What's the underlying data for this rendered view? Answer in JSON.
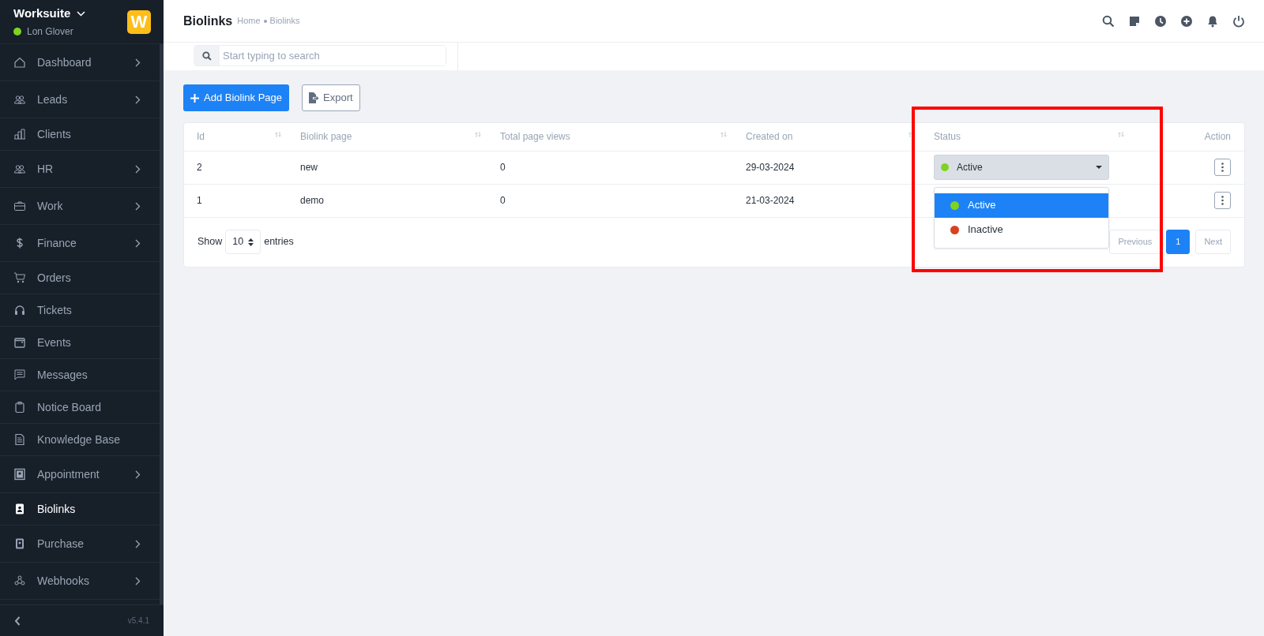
{
  "sidebar": {
    "company": "Worksuite",
    "user": "Lon Glover",
    "online": true,
    "logo_letter": "W",
    "items": [
      {
        "label": "Dashboard",
        "has_submenu": true,
        "selected": false
      },
      {
        "label": "Leads",
        "has_submenu": true,
        "selected": false
      },
      {
        "label": "Clients",
        "has_submenu": false,
        "selected": false
      },
      {
        "label": "HR",
        "has_submenu": true,
        "selected": false
      },
      {
        "label": "Work",
        "has_submenu": true,
        "selected": false
      },
      {
        "label": "Finance",
        "has_submenu": true,
        "selected": false
      },
      {
        "label": "Orders",
        "has_submenu": false,
        "selected": false
      },
      {
        "label": "Tickets",
        "has_submenu": false,
        "selected": false
      },
      {
        "label": "Events",
        "has_submenu": false,
        "selected": false
      },
      {
        "label": "Messages",
        "has_submenu": false,
        "selected": false
      },
      {
        "label": "Notice Board",
        "has_submenu": false,
        "selected": false
      },
      {
        "label": "Knowledge Base",
        "has_submenu": false,
        "selected": false
      },
      {
        "label": "Appointment",
        "has_submenu": true,
        "selected": false
      },
      {
        "label": "Biolinks",
        "has_submenu": false,
        "selected": true
      },
      {
        "label": "Purchase",
        "has_submenu": true,
        "selected": false
      },
      {
        "label": "Webhooks",
        "has_submenu": true,
        "selected": false
      }
    ],
    "version": "v5.4.1"
  },
  "header": {
    "title": "Biolinks",
    "breadcrumb": [
      "Home",
      "Biolinks"
    ]
  },
  "search": {
    "placeholder": "Start typing to search"
  },
  "actions": [
    {
      "label": "Add Biolink Page",
      "kind": "primary"
    },
    {
      "label": "Export",
      "kind": "outline"
    }
  ],
  "table": {
    "columns": [
      "Id",
      "Biolink page",
      "Total page views",
      "Created on",
      "Status",
      "Action"
    ],
    "rows": [
      {
        "id": "2",
        "page": "new",
        "views": "0",
        "created": "29-03-2024",
        "status": {
          "label": "Active",
          "color": "#7ed321"
        }
      },
      {
        "id": "1",
        "page": "demo",
        "views": "0",
        "created": "21-03-2024"
      }
    ],
    "status_menu": [
      {
        "label": "Active",
        "color": "#7ed321",
        "selected": true
      },
      {
        "label": "Inactive",
        "color": "#d9411e",
        "selected": false
      }
    ],
    "page_length": {
      "before": "Show",
      "value": "10",
      "after": "entries"
    },
    "pagination": [
      {
        "label": "Previous",
        "selected": false
      },
      {
        "label": "1",
        "selected": true
      },
      {
        "label": "Next",
        "selected": false
      }
    ]
  }
}
